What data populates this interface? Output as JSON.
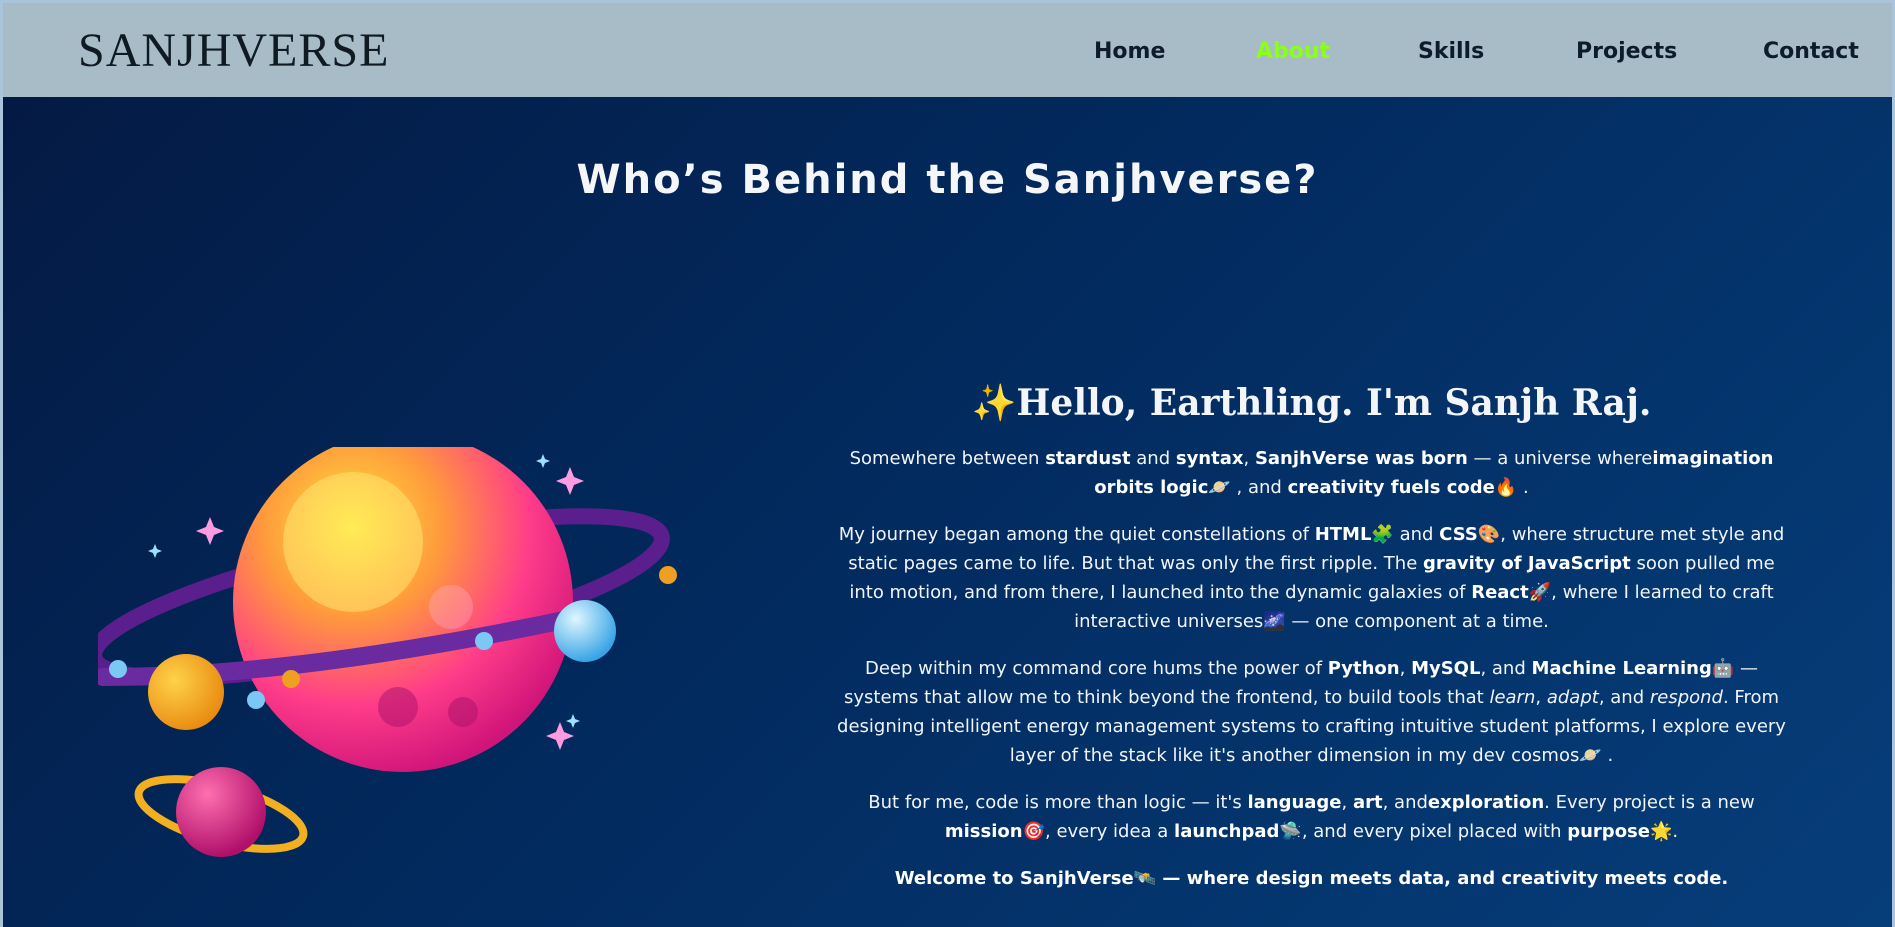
{
  "brand": {
    "logo": "SANJHVERSE"
  },
  "nav": {
    "items": [
      {
        "label": "Home",
        "active": false
      },
      {
        "label": "About",
        "active": true
      },
      {
        "label": "Skills",
        "active": false
      },
      {
        "label": "Projects",
        "active": false
      },
      {
        "label": "Contact",
        "active": false
      }
    ],
    "active_color": "#8aff1a"
  },
  "about": {
    "title": "Who’s Behind the Sanjhverse?",
    "greeting_icon": "✨",
    "greeting": "Hello, Earthling. I'm Sanjh Raj.",
    "p1": {
      "t1": "Somewhere between ",
      "b1": "stardust",
      "t2": " and ",
      "b2": "syntax",
      "t3": ", ",
      "b3": "SanjhVerse was born",
      "t4": " — a universe where",
      "b4": "imagination orbits logic",
      "e1": "🪐",
      "t5": " , and ",
      "b5": "creativity fuels code",
      "e2": "🔥",
      "t6": " ."
    },
    "p2": {
      "t1": "My journey began among the quiet constellations of ",
      "b1": "HTML",
      "e1": "🧩",
      "t2": " and ",
      "b2": "CSS",
      "e2": "🎨",
      "t3": ", where structure met style and static pages came to life. But that was only the first ripple. The ",
      "b3": "gravity of JavaScript",
      "t4": " soon pulled me into motion, and from there, I launched into the dynamic galaxies of ",
      "b4": "React",
      "e3": "🚀",
      "t5": ", where I learned to craft interactive universes",
      "e4": "🌌",
      "t6": " — one component at a time."
    },
    "p3": {
      "t1": "Deep within my command core hums the power of ",
      "b1": "Python",
      "t2": ", ",
      "b2": "MySQL",
      "t3": ", and ",
      "b3": "Machine Learning",
      "e1": "🤖",
      "t4": " — systems that allow me to think beyond the frontend, to build tools that ",
      "i1": "learn",
      "t5": ", ",
      "i2": "adapt",
      "t6": ", and ",
      "i3": "respond",
      "t7": ". From designing intelligent energy management systems to crafting intuitive student platforms, I explore every layer of the stack like it's another dimension in my dev cosmos",
      "e2": "🪐",
      "t8": " ."
    },
    "p4": {
      "t1": "But for me, code is more than logic — it's ",
      "b1": "language",
      "t2": ", ",
      "b2": "art",
      "t3": ", and",
      "b3": "exploration",
      "t4": ". Every project is a new ",
      "b4": "mission",
      "e1": "🎯",
      "t5": ", every idea a ",
      "b5": "launchpad",
      "e2": "🛸",
      "t6": ", and every pixel placed with ",
      "b6": "purpose",
      "e3": "🌟",
      "t7": "."
    },
    "p5": {
      "b1": "Welcome to SanjhVerse",
      "e1": "🛰️",
      "b2": " — where design meets data, and creativity meets code."
    }
  }
}
